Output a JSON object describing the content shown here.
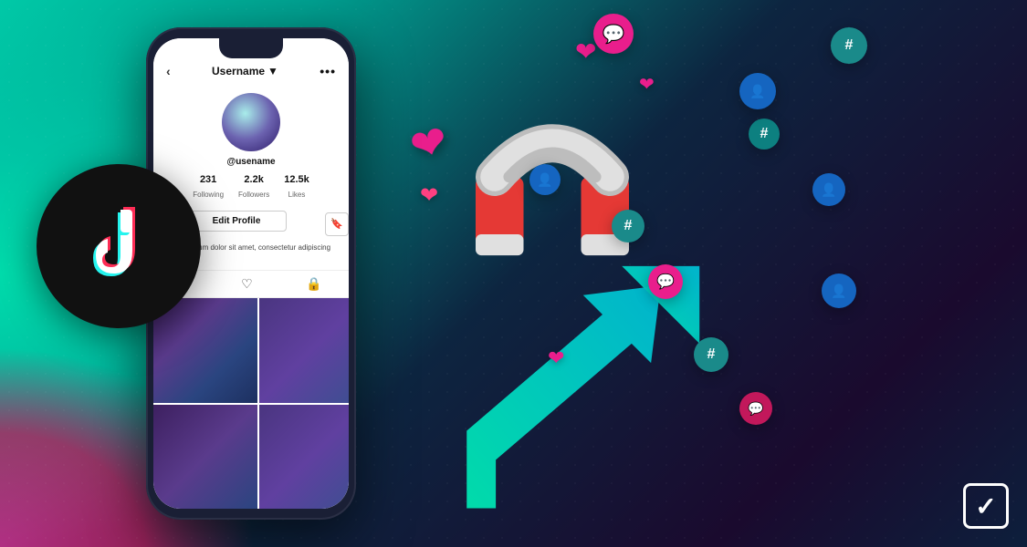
{
  "background": {
    "primary_color": "#0a1628",
    "teal_color": "#00c9a7",
    "pink_color": "#e91e8c"
  },
  "tiktok_logo": {
    "circle_color": "#111111"
  },
  "phone": {
    "header": {
      "back_label": "‹",
      "username_label": "Username",
      "dropdown_icon": "▼",
      "more_icon": "•••"
    },
    "profile": {
      "handle": "@usename",
      "stats": [
        {
          "number": "231",
          "label": "Following"
        },
        {
          "number": "2.2k",
          "label": "Followers"
        },
        {
          "number": "12.5k",
          "label": "Likes"
        }
      ],
      "edit_profile_label": "Edit Profile",
      "bookmark_icon": "🔖",
      "bio": "Lorem ipsum dolor sit amet, consectetur adipiscing elit."
    },
    "tabs": [
      {
        "icon": "≡"
      },
      {
        "icon": "♡"
      },
      {
        "icon": "🔒"
      }
    ]
  },
  "floating_elements": {
    "hearts": [
      "❤",
      "❤",
      "❤",
      "❤"
    ],
    "hashtags": [
      "#",
      "#",
      "#",
      "#"
    ],
    "users": [
      "👤",
      "👤",
      "👤",
      "👤"
    ],
    "chats": [
      "💬",
      "💬"
    ]
  },
  "watermark": {
    "icon": "✓"
  }
}
